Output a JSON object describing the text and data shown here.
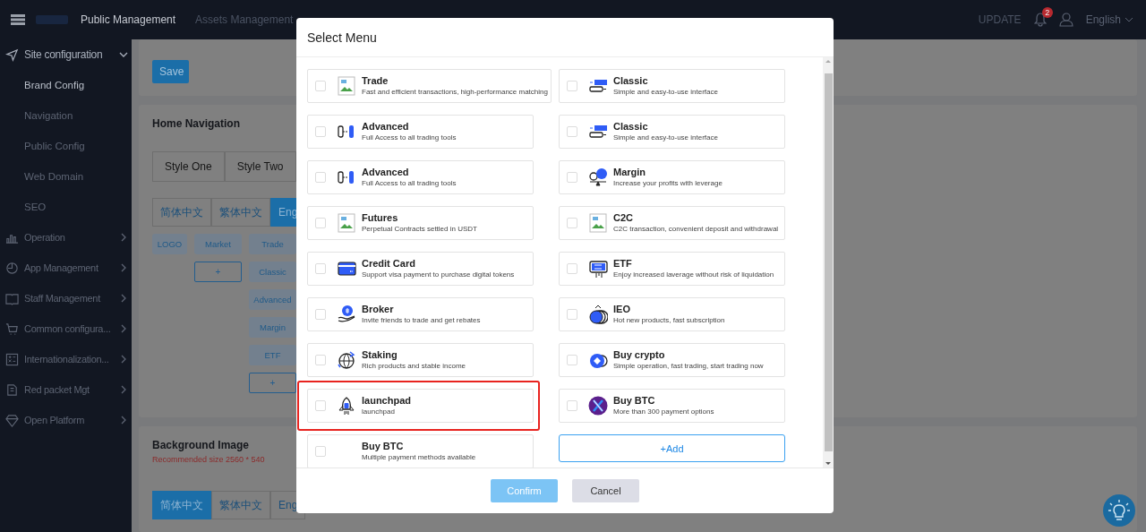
{
  "topbar": {
    "nav": [
      {
        "label": "Public Management",
        "selected": true
      },
      {
        "label": "Assets Management",
        "selected": false
      }
    ],
    "update": "UPDATE",
    "notifications": "2",
    "language": "English"
  },
  "sidebar": {
    "items": [
      {
        "label": "Site configuration",
        "expanded": true,
        "children": [
          {
            "label": "Brand Config",
            "selected": true
          },
          {
            "label": "Navigation",
            "selected": false
          },
          {
            "label": "Public Config",
            "selected": false
          },
          {
            "label": "Web Domain",
            "selected": false
          },
          {
            "label": "SEO",
            "selected": false
          }
        ]
      },
      {
        "label": "Operation",
        "expanded": false
      },
      {
        "label": "App Management",
        "expanded": false
      },
      {
        "label": "Staff Management",
        "expanded": false
      },
      {
        "label": "Common configura...",
        "expanded": false
      },
      {
        "label": "Internationalization...",
        "expanded": false
      },
      {
        "label": "Red packet Mgt",
        "expanded": false
      },
      {
        "label": "Open Platform",
        "expanded": false
      }
    ]
  },
  "content": {
    "save": "Save",
    "home_navigation": {
      "title": "Home Navigation",
      "styles": [
        {
          "label": "Style One",
          "selected": false
        },
        {
          "label": "Style Two",
          "selected": false
        }
      ],
      "languages": [
        {
          "label": "简体中文",
          "selected": false
        },
        {
          "label": "繁体中文",
          "selected": false
        },
        {
          "label": "Eng",
          "selected": true
        }
      ],
      "nav_columns": [
        {
          "items": [
            "LOGO"
          ]
        },
        {
          "items": [
            "Market"
          ],
          "add": "+"
        },
        {
          "items": [
            "Trade",
            "Classic",
            "Advanced",
            "Margin",
            "ETF"
          ],
          "add": "+"
        }
      ]
    },
    "background_image": {
      "title": "Background Image",
      "note": "Recommended size 2560 * 540",
      "languages": [
        {
          "label": "简体中文",
          "selected": true
        },
        {
          "label": "繁体中文",
          "selected": false
        },
        {
          "label": "Eng",
          "selected": false
        }
      ]
    }
  },
  "modal": {
    "title": "Select Menu",
    "left": [
      {
        "title": "Trade",
        "description": "Fast and efficient transactions, high-performance matching",
        "checked": false,
        "highlighted": false
      },
      {
        "title": "Advanced",
        "description": "Full Access to all trading tools",
        "checked": false,
        "highlighted": false
      },
      {
        "title": "Advanced",
        "description": "Full Access to all trading tools",
        "checked": false,
        "highlighted": false
      },
      {
        "title": "Futures",
        "description": "Perpetual Contracts settled in USDT",
        "checked": false,
        "highlighted": false
      },
      {
        "title": "Credit Card",
        "description": "Support visa payment to purchase digital tokens",
        "checked": false,
        "highlighted": false
      },
      {
        "title": "Broker",
        "description": "Invite friends to trade and get rebates",
        "checked": false,
        "highlighted": false
      },
      {
        "title": "Staking",
        "description": "Rich products and stable income",
        "checked": false,
        "highlighted": false
      },
      {
        "title": "launchpad",
        "description": "launchpad",
        "checked": false,
        "highlighted": true
      },
      {
        "title": "Buy BTC",
        "description": "Multiple payment methods available",
        "checked": false,
        "highlighted": false
      }
    ],
    "right": [
      {
        "title": "Classic",
        "description": "Simple and easy-to-use interface",
        "checked": false,
        "highlighted": false
      },
      {
        "title": "Classic",
        "description": "Simple and easy-to-use interface",
        "checked": false,
        "highlighted": false
      },
      {
        "title": "Margin",
        "description": "Increase your profits with leverage",
        "checked": false,
        "highlighted": false
      },
      {
        "title": "C2C",
        "description": "C2C transaction, convenient deposit and withdrawal",
        "checked": false,
        "highlighted": false
      },
      {
        "title": "ETF",
        "description": "Enjoy increased laverage without risk of liquidation",
        "checked": false,
        "highlighted": false
      },
      {
        "title": "IEO",
        "description": "Hot new products, fast subscription",
        "checked": false,
        "highlighted": false
      },
      {
        "title": "Buy crypto",
        "description": "Simple operation, fast trading, start trading now",
        "checked": false,
        "highlighted": false
      },
      {
        "title": "Buy BTC",
        "description": "More than 300 payment options",
        "checked": false,
        "highlighted": false
      }
    ],
    "add": "+Add",
    "confirm": "Confirm",
    "cancel": "Cancel"
  }
}
